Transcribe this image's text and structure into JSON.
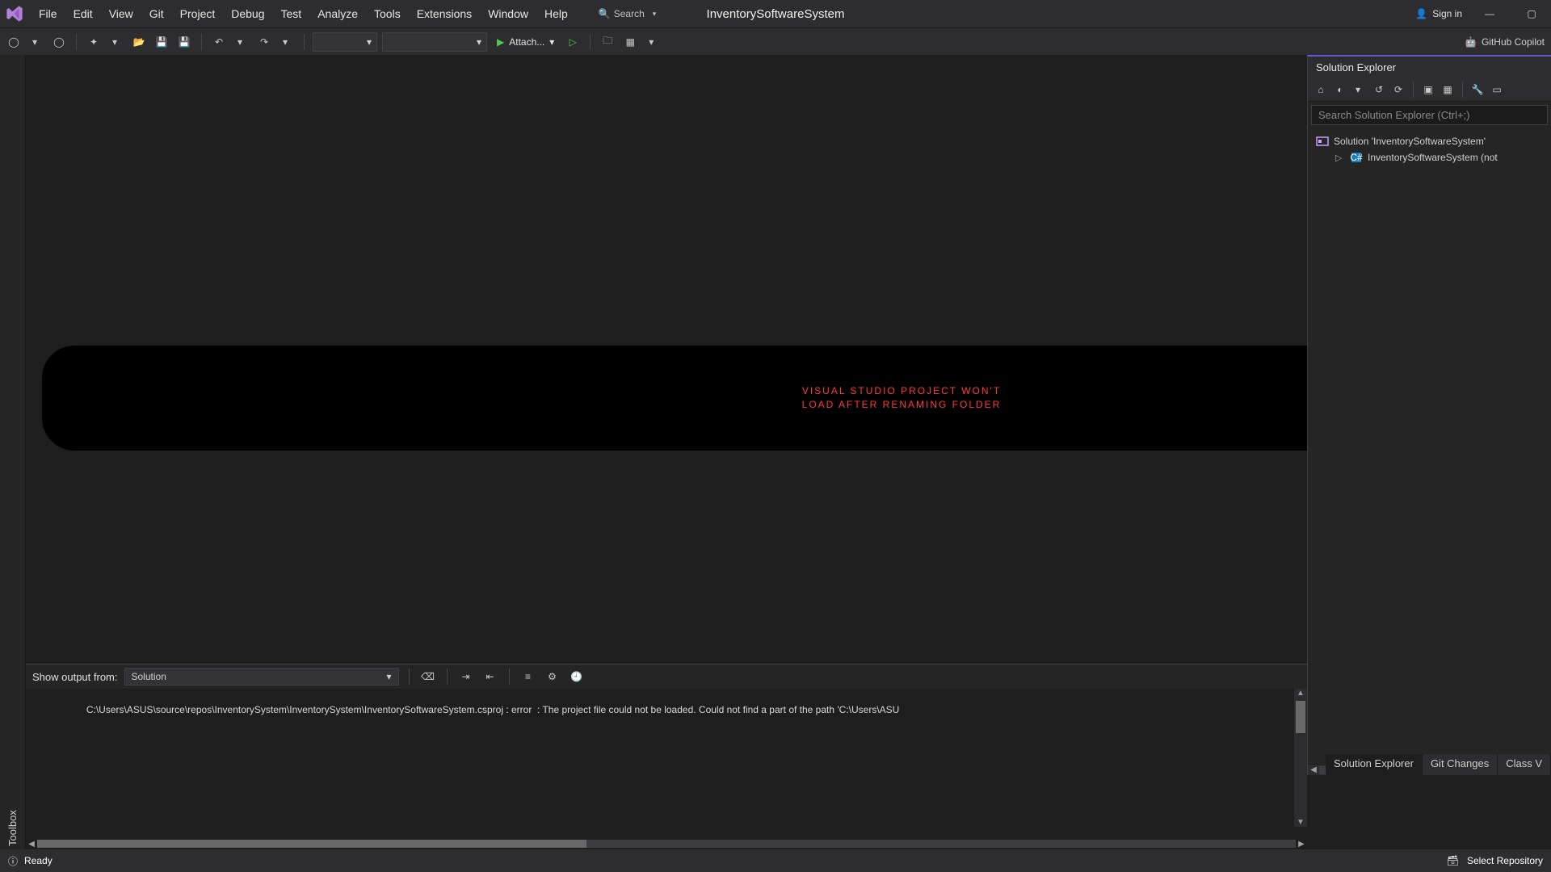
{
  "menu": {
    "items": [
      "File",
      "Edit",
      "View",
      "Git",
      "Project",
      "Debug",
      "Test",
      "Analyze",
      "Tools",
      "Extensions",
      "Window",
      "Help"
    ],
    "search_label": "Search",
    "project_title": "InventorySoftwareSystem",
    "sign_in": "Sign in",
    "copilot": "GitHub Copilot"
  },
  "toolbar": {
    "combo1": "",
    "combo2": "",
    "attach": "Attach..."
  },
  "sidebar": {
    "toolbox": "Toolbox"
  },
  "overlay": {
    "line1": "VISUAL STUDIO PROJECT WON'T",
    "line2": "LOAD AFTER RENAMING FOLDER"
  },
  "solution_explorer": {
    "title": "Solution Explorer",
    "search_placeholder": "Search Solution Explorer (Ctrl+;)",
    "root": "Solution 'InventorySoftwareSystem'",
    "project": "InventorySoftwareSystem (not"
  },
  "output": {
    "show_output_label": "Show output from:",
    "source": "Solution",
    "log": "C:\\Users\\ASUS\\source\\repos\\InventorySystem\\InventorySystem\\InventorySoftwareSystem.csproj : error  : The project file could not be loaded. Could not find a part of the path 'C:\\Users\\ASU"
  },
  "bottom_tabs": {
    "t1": "Solution Explorer",
    "t2": "Git Changes",
    "t3": "Class V"
  },
  "status": {
    "ready": "Ready",
    "select_repo": "Select Repository"
  }
}
